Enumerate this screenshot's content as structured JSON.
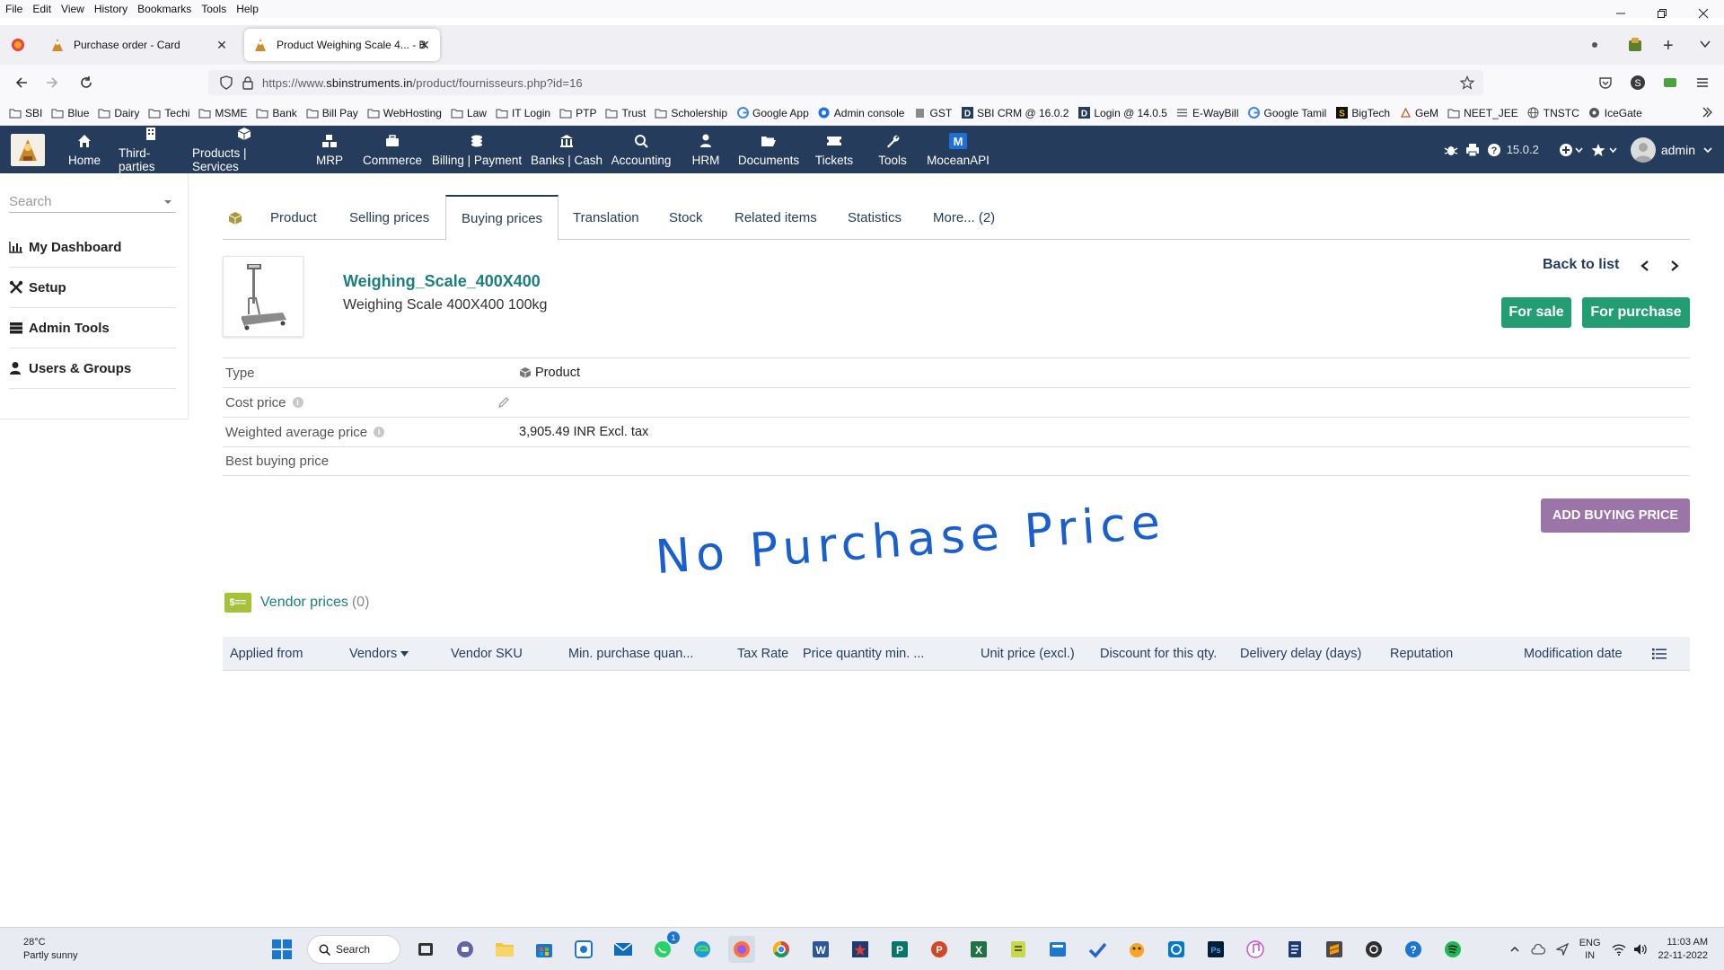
{
  "browser": {
    "menu": [
      "File",
      "Edit",
      "View",
      "History",
      "Bookmarks",
      "Tools",
      "Help"
    ],
    "tabs": [
      {
        "title": "Purchase order - Card",
        "active": false
      },
      {
        "title": "Product Weighing Scale 4... - B",
        "active": true
      }
    ],
    "url_prefix": "https://www.",
    "url_host": "sbinstruments.in",
    "url_path": "/product/fournisseurs.php?id=16",
    "bookmarks": [
      "SBI",
      "Blue",
      "Dairy",
      "Techi",
      "MSME",
      "Bank",
      "Bill Pay",
      "WebHosting",
      "Law",
      "IT Login",
      "PTP",
      "Trust",
      "Scholership",
      "Google App",
      "Admin console",
      "GST",
      "SBI CRM @ 16.0.2",
      "Login @ 14.0.5",
      "E-WayBill",
      "Google Tamil",
      "BigTech",
      "GeM",
      "NEET_JEE",
      "TNSTC",
      "IceGate"
    ]
  },
  "appbar": {
    "menu": [
      "Home",
      "Third-parties",
      "Products | Services",
      "MRP",
      "Commerce",
      "Billing | Payment",
      "Banks | Cash",
      "Accounting",
      "HRM",
      "Documents",
      "Tickets",
      "Tools",
      "MoceanAPI"
    ],
    "version": "15.0.2",
    "user": "admin",
    "mocean_letter": "M",
    "color": "#263c5c"
  },
  "sidebar": {
    "search_placeholder": "Search",
    "items": [
      "My Dashboard",
      "Setup",
      "Admin Tools",
      "Users & Groups"
    ]
  },
  "tabs": [
    "Product",
    "Selling prices",
    "Buying prices",
    "Translation",
    "Stock",
    "Related items",
    "Statistics",
    "More... (2)"
  ],
  "product": {
    "ref": "Weighing_Scale_400X400",
    "label": "Weighing Scale 400X400 100kg",
    "back_to_list": "Back to list",
    "for_sale": "For sale",
    "for_purchase": "For purchase"
  },
  "fields": [
    {
      "label": "Type",
      "value": "Product"
    },
    {
      "label": "Cost price",
      "value": ""
    },
    {
      "label": "Weighted average price",
      "value": "3,905.49 INR Excl. tax"
    },
    {
      "label": "Best buying price",
      "value": ""
    }
  ],
  "info_glyph": "i",
  "annotation": "No Purchase Price",
  "add_buying_price": "ADD BUYING PRICE",
  "vendor": {
    "icon_text": "$==",
    "title": "Vendor prices",
    "count": "(0)",
    "columns": [
      "Applied from",
      "Vendors",
      "Vendor SKU",
      "Min. purchase quan...",
      "Tax Rate",
      "Price quantity min. ...",
      "Unit price (excl.)",
      "Discount for this qty.",
      "Delivery delay (days)",
      "Reputation",
      "Modification date"
    ]
  },
  "taskbar": {
    "temp": "28°C",
    "weather": "Partly sunny",
    "search": "Search",
    "lang1": "ENG",
    "lang2": "IN",
    "time": "11:03 AM",
    "date": "22-11-2022",
    "notif_badge": "1"
  }
}
